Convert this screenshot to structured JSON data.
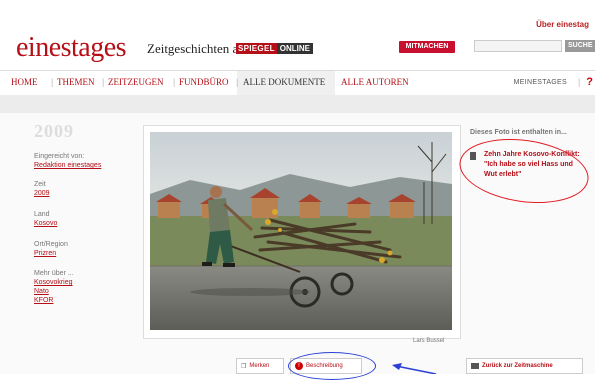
{
  "header": {
    "top_link": "Über einestag",
    "logo": "einestages",
    "subtitle": "Zeitgeschichten auf",
    "spiegel_part1": "SPIEGEL",
    "spiegel_part2": "ONLINE",
    "mitmachen": "MITMACHEN",
    "search_placeholder": "",
    "search_button": "SUCHE"
  },
  "nav": {
    "items": [
      "HOME",
      "THEMEN",
      "ZEITZEUGEN",
      "FUNDBÜRO",
      "ALLE DOKUMENTE",
      "ALLE AUTOREN"
    ],
    "meinestages": "MEINESTAGES",
    "help": "?"
  },
  "left": {
    "year": "2009",
    "eingereicht_label": "Eingereicht von:",
    "eingereicht_value": "Redaktion einestages",
    "zeit_label": "Zeit",
    "zeit_value": "2009",
    "land_label": "Land",
    "land_value": "Kosovo",
    "ort_label": "Ort/Region",
    "ort_value": "Prizren",
    "mehr_label": "Mehr über ...",
    "mehr_items": [
      "Kosovokrieg",
      "Nato",
      "KFOR"
    ]
  },
  "photo": {
    "credit": "Lars Bussel"
  },
  "right": {
    "title": "Dieses Foto ist enthalten in...",
    "link": "Zehn Jahre Kosovo-Konflikt: \"Ich habe so viel Hass und Wut erlebt\""
  },
  "bottom": {
    "merken": "Merken",
    "beschreibung": "Beschreibung",
    "zurueck": "Zurück zur Zeitmaschine"
  },
  "colors": {
    "brand_red": "#b50f17",
    "annotation": "#e31b23",
    "annotation_arrow": "#2a3fd6"
  }
}
